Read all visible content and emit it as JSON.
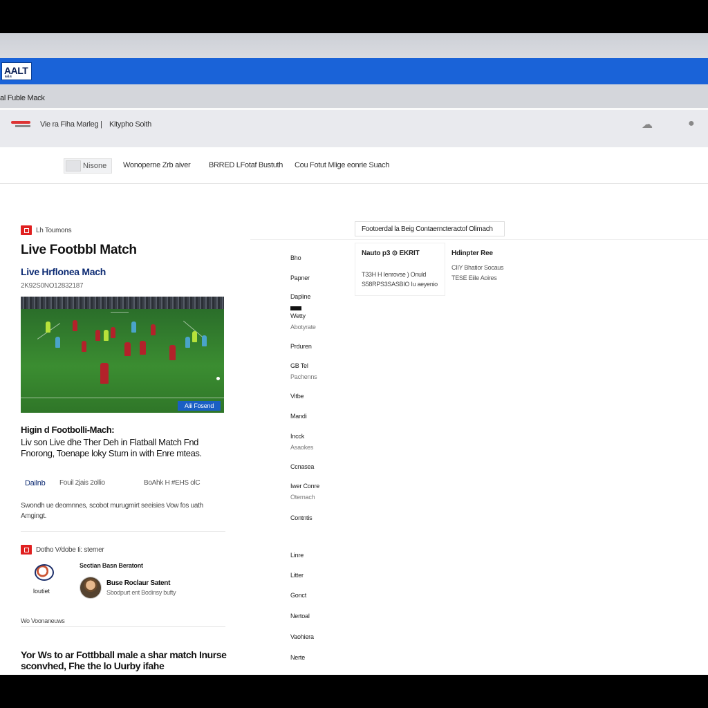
{
  "browser": {
    "logo_text": "AALT",
    "logo_sub": "a & s",
    "page_title": "al Fuble Mack"
  },
  "nav": {
    "links": [
      "Vie ra Fiha Marleg |",
      "Kitypho Soith"
    ],
    "icons": [
      "cloud-icon",
      "user-icon"
    ]
  },
  "subnav": {
    "chip_label": "Nisone",
    "links": [
      "Wonoperne Zrb aiver",
      "BRRED LFotaf Bustuth",
      "Cou Fotut Mlige eonrie Suach"
    ]
  },
  "article": {
    "section_label": "Lh Toumons",
    "headline": "Live Footbbl Match",
    "subhead": "Live Hrflonea Mach",
    "dateline": "2K92S0NO12832187",
    "hero_badge": "Aiii Fosend",
    "story_title": "Higin d Footbolli-Mach:",
    "story_body": "Liv son Live dhe Ther Deh in Flatball Match Fnd Fnorong, Toenape loky Stum in with Enre mteas.",
    "author": "Dailnb",
    "meta_date": "Fouil 2jais 2ollio",
    "meta_info": "BoAhk H  #EHS olC",
    "excerpt": "Swondh ue deomnnes, scobot murugmirt seeisies Vow fos uath Amgingt."
  },
  "author_block": {
    "section_label": "Dotho V/dobe Ii: sterner",
    "emblem_label": "loutiet",
    "section_title": "Sectian Basn Beratont",
    "name": "Buse Roclaur Satent",
    "description": "Sbodpurt ent Bodinsy bufty",
    "more_label": "Wo Voonaneuws"
  },
  "bottom_title": "Yor Ws to ar Fottbball male a shar match Inurse sconvhed, Fhe the lo Uurby ifahe",
  "side_menu": [
    {
      "label": "Bho",
      "sub": ""
    },
    {
      "label": "Papner",
      "sub": ""
    },
    {
      "label": "Dapline",
      "sub": ""
    },
    {
      "label": "Wetty",
      "sub": "Abotyrate"
    },
    {
      "label": "Prduren",
      "sub": ""
    },
    {
      "label": "GB Tel",
      "sub": "Pachenns"
    },
    {
      "label": "Vitbe",
      "sub": ""
    },
    {
      "label": "Mandi",
      "sub": ""
    },
    {
      "label": "Incck",
      "sub": "Asaokes"
    },
    {
      "label": "Ccnasea",
      "sub": ""
    },
    {
      "label": "Iwer Conre",
      "sub": "Oternach"
    },
    {
      "label": "Contntis",
      "sub": ""
    },
    {
      "label": "Linre",
      "sub": ""
    },
    {
      "label": "Litter",
      "sub": ""
    },
    {
      "label": "Gonct",
      "sub": ""
    },
    {
      "label": "Nertoal",
      "sub": ""
    },
    {
      "label": "Vaohiera",
      "sub": ""
    },
    {
      "label": "Nerte",
      "sub": ""
    }
  ],
  "scoreboard": {
    "title": "Footoerdal la Beig Contaerncteractof Olimach",
    "card_head": "Nauto p3  ⊙  EKRIT",
    "card_lines": [
      "T33H H Ienrovse ) Onuld",
      "S58RPS3SASBIO Iu aeyenio"
    ],
    "side_head": "Hdinpter Ree",
    "side_lines": [
      "CIIY Bhatior Socaus",
      "TESE Eiile Aoires"
    ]
  }
}
